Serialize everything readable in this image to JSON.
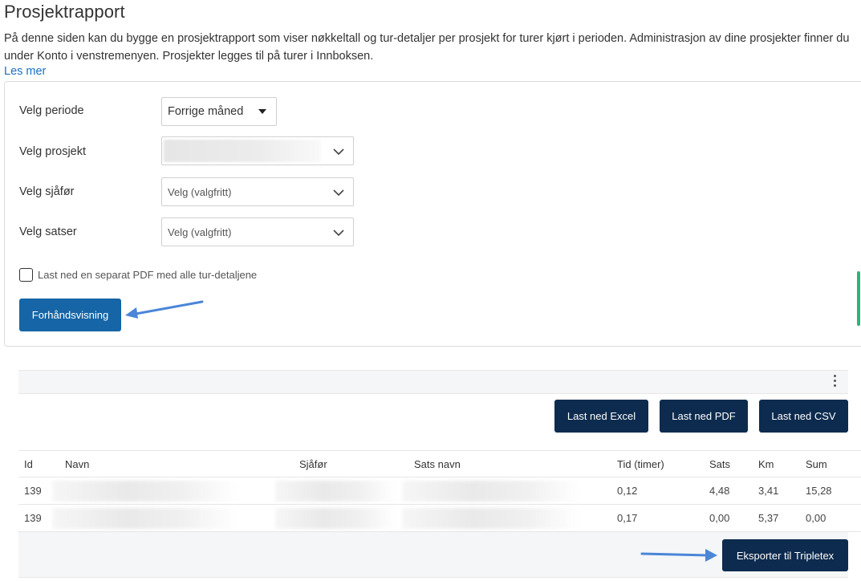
{
  "page": {
    "title": "Prosjektrapport",
    "intro": "På denne siden kan du bygge en prosjektrapport som viser nøkkeltall og tur-detaljer per prosjekt for turer kjørt i perioden. Administrasjon av dine prosjekter finner du under Konto i venstremenyen. Prosjekter legges til på turer i Innboksen.",
    "read_more": "Les mer"
  },
  "form": {
    "period_label": "Velg periode",
    "period_value": "Forrige måned",
    "project_label": "Velg prosjekt",
    "project_value": "",
    "driver_label": "Velg sjåfør",
    "driver_placeholder": "Velg (valgfritt)",
    "rates_label": "Velg satser",
    "rates_placeholder": "Velg (valgfritt)",
    "checkbox_label": "Last ned en separat PDF med alle tur-detaljene",
    "checkbox_checked": false,
    "preview_button": "Forhåndsvisning"
  },
  "downloads": {
    "excel": "Last ned Excel",
    "pdf": "Last ned PDF",
    "csv": "Last ned CSV"
  },
  "table": {
    "columns": [
      "Id",
      "Navn",
      "Sjåfør",
      "Sats navn",
      "Tid (timer)",
      "Sats",
      "Km",
      "Sum"
    ],
    "rows": [
      {
        "id": "139",
        "navn": "",
        "sjafor": "",
        "sats_navn": "",
        "tid": "0,12",
        "sats": "4,48",
        "km": "3,41",
        "sum": "15,28"
      },
      {
        "id": "139",
        "navn": "",
        "sjafor": "",
        "sats_navn": "",
        "tid": "0,17",
        "sats": "0,00",
        "km": "5,37",
        "sum": "0,00"
      }
    ]
  },
  "export_button": "Eksporter til Tripletex",
  "colors": {
    "primary": "#1565a7",
    "dark_button": "#0d2b4e",
    "link": "#1a6fc2",
    "annotation_arrow": "#4a86d8",
    "accent_edge": "#2bb37a"
  },
  "icons": {
    "period_caret": "caret-down-icon",
    "select_chevron": "chevron-down-icon",
    "table_menu": "kebab-menu-icon"
  }
}
